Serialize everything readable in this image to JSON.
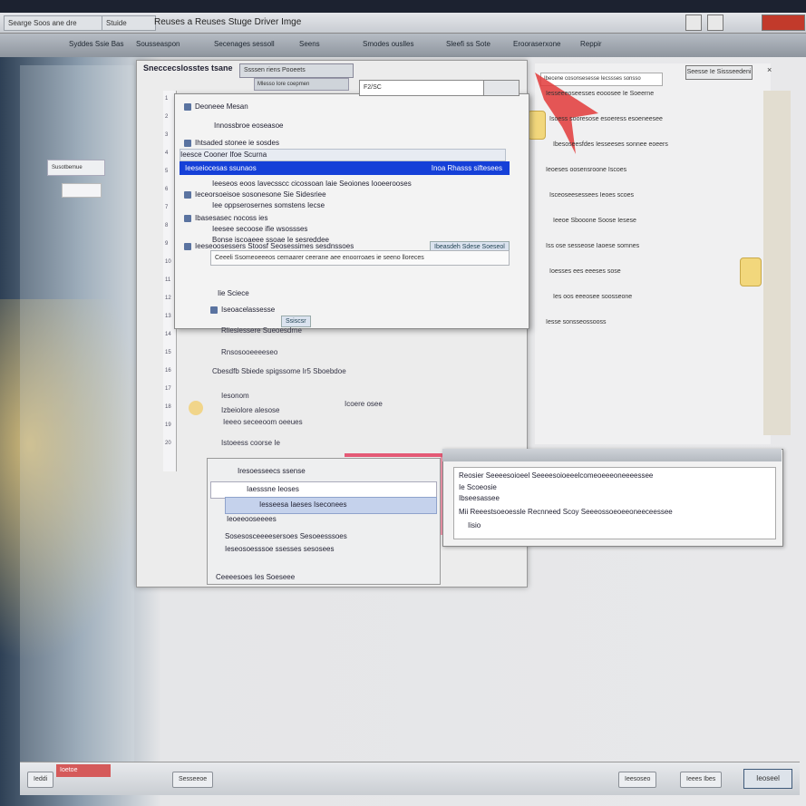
{
  "window": {
    "title": "Reuses a Reuses Stuge Driver Imge",
    "tabs": [
      "Searge Soos ane dre",
      "Stuide"
    ],
    "menu": [
      "Syddes Ssie Bas",
      "Sousseaspon",
      "Secenages sessoll",
      "Seens",
      "Smodes ouslles",
      "Sleefi ss Sote",
      "Erooraserxone",
      "Reppir"
    ]
  },
  "left": {
    "card_label": "Susotbemue"
  },
  "main": {
    "title": "Sneccecslosstes tsane",
    "toolbar_label": "Ssssen riens Pooeets",
    "toolbar_sub": "Mlesso Iore coepmen",
    "gutter_numbers": [
      "1",
      "2",
      "3",
      "4",
      "5",
      "6",
      "7",
      "8",
      "9",
      "10",
      "11",
      "12",
      "13",
      "14",
      "15",
      "16",
      "17",
      "18",
      "19",
      "20"
    ]
  },
  "dialog": {
    "field_value": "F2/SC",
    "header": "Deoneee Mesan",
    "row_intro": "Innossbroe eoseasoe",
    "row_parent": "Ihtsaded stonee ie sosdes",
    "row_hint": "Ieesce Cooner Ifoe Scurna",
    "selected_left": "Ieeseiocesas ssunaos",
    "selected_right": "Inoa Rhasss siftesees",
    "rows": [
      "Ieeseos eoos Iavecsscc cicossoan Iaie Seoiones Iooeerooses",
      "Ieceorsoeisoe sosonesone Sie Sidesriee",
      "Iee oppserosernes somstens Iecse",
      "Ibasesasec nocoss ies",
      "Ieesee secoose ifie wsossses",
      "Bonse iscoaeee ssoae Ie sesreddee",
      "Ieeseoosessers Stoosf Seosessimes sesdnssoes"
    ],
    "right_tags": [
      "Ibeasdeh Sdese Soeseol"
    ],
    "mini_button": "Iseeone",
    "search_text": "Ceeeli Ssomeoeeeos cemaarer ceerane aee enoorroaes ie seeno lloreces",
    "sub_rows": [
      "Iie Sciece",
      "Iseoacelassesse"
    ],
    "link_text": "Ssiscsr"
  },
  "main_below": {
    "row1": "Rliesiessere Sueoesdrne",
    "row2": "Rnsosooeeeeseo",
    "row3": "Cbesdfb Sbiede spigssome Ir5 Sboebdoe",
    "row4": "Iesonom",
    "row5": "Izbeiolore alesose",
    "row6": "Ieeeo seceeoom oeeues",
    "row7": "Istoeess coorse Ie",
    "link": "Icoere osee"
  },
  "right_doc": {
    "find": "Ibecene cosonsesesse Iecssses sonsso",
    "button": "Seesse Ie Sissseedeni",
    "lines": [
      "Iesseeeoseesses eooosee Ie Soeerne",
      "Isoess sooresose esoeress esoeneesee",
      "Ibesoseesfdes Iesseeses sonnee eoeers",
      "Ieoeses oosensroone Iscoes",
      "Isceoseesessees Ieoes scoes",
      "Ieeoe Sbooone Soose Iesese",
      "Iss ose sesseose Iaoese somnes",
      "Ioesses ees eeeses sose",
      "Ies oos eeeosee soosseone",
      "Iesse sonsseossooss"
    ]
  },
  "bottom_window": {
    "line1": "Reosier Seeeesoioeel Seeeesoioeeelcomeoeeeoneeeessee",
    "line2": "Ie Scoeosie",
    "line3": "Ibseesassee",
    "line4": "Mii Reeestsoeoessle Recnneed Scoy Seeeossoeoeeoneeceessee",
    "line5": "Iisio"
  },
  "sub_panel": {
    "header": "Iresoesseecs ssense",
    "sel1": "Iaesssne Ieoses",
    "sel2": "Iesseesa Iaeses Iseconees",
    "row1": "Ieoeeooseeees",
    "row2": "Sosesosceeeesersoes Sesoeesssoes",
    "row3": "Ieseosoesssoe ssesses sesosees",
    "footer": "Ceeeesoes Ies Soeseee"
  },
  "status": {
    "left_btn": "Ieddi",
    "red_label": "Ioetoe",
    "mid_btn": "Sesseeoe",
    "right_btn1": "Ieesoseo",
    "right_btn2": "Ieees Ibes",
    "ok": "Ieoseel"
  },
  "colors": {
    "selection": "#1540d8",
    "accent_red": "#e45a76",
    "sticky": "#f2d77c"
  }
}
